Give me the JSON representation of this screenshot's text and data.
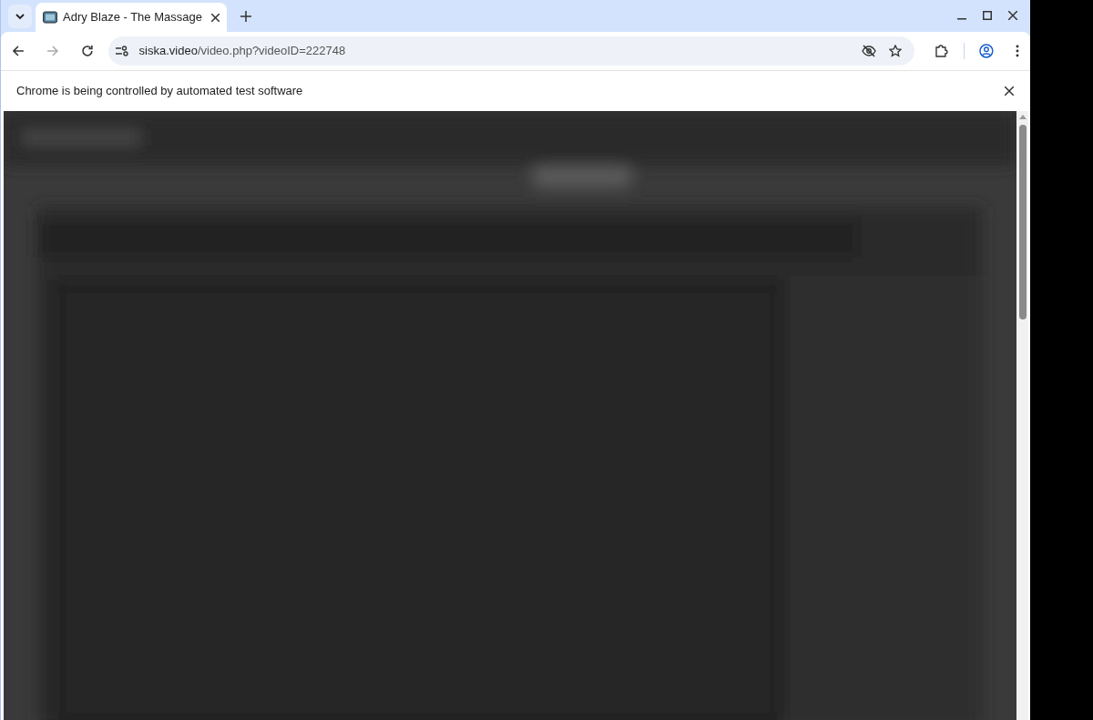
{
  "tabs": [
    {
      "title": "Adry Blaze - The Massage",
      "selected": true
    }
  ],
  "address_bar": {
    "domain": "siska.video",
    "path": "/video.php?videoID=222748"
  },
  "infobar": {
    "message": "Chrome is being controlled by automated test software"
  }
}
